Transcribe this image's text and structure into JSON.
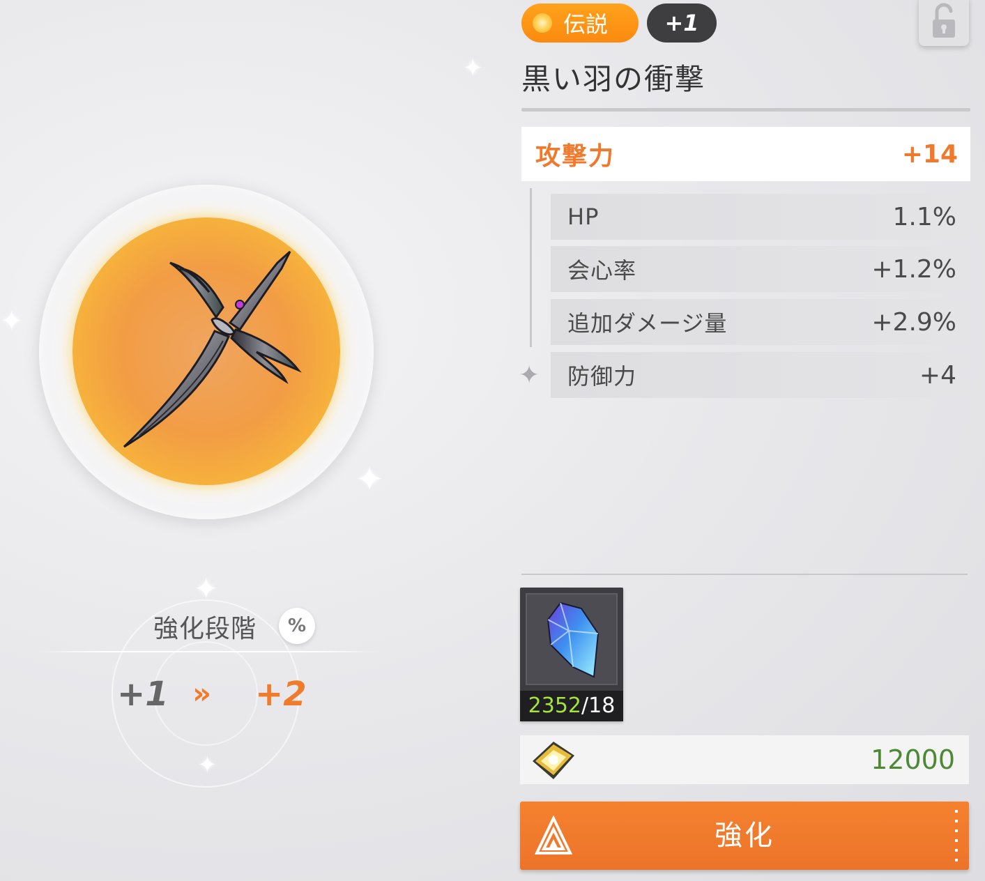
{
  "item": {
    "rarity": "伝説",
    "level": "+1",
    "name": "黒い羽の衝撃"
  },
  "main_stat": {
    "label": "攻撃力",
    "value": "+14"
  },
  "sub_stats": [
    {
      "label": "HP",
      "value": "1.1%"
    },
    {
      "label": "会心率",
      "value": "+1.2%"
    },
    {
      "label": "追加ダメージ量",
      "value": "+2.9%"
    },
    {
      "label": "防御力",
      "value": "+4"
    }
  ],
  "enhance_stage": {
    "label": "強化段階",
    "percent_button": "%",
    "from": "+1",
    "arrow": "»",
    "to": "+2"
  },
  "material": {
    "have": "2352",
    "separator": "/",
    "need": "18"
  },
  "cost": {
    "gold": "12000"
  },
  "enhance_button": {
    "label": "強化"
  },
  "colors": {
    "accent": "#ef7a2d",
    "legendary": "#fb8a10",
    "material_have": "#a6e33c",
    "cost": "#4b8a33"
  },
  "icons": [
    "lock-icon",
    "gem-crystal-icon",
    "gold-coin-icon",
    "upgrade-arrow-icon",
    "sparkle-icon"
  ]
}
